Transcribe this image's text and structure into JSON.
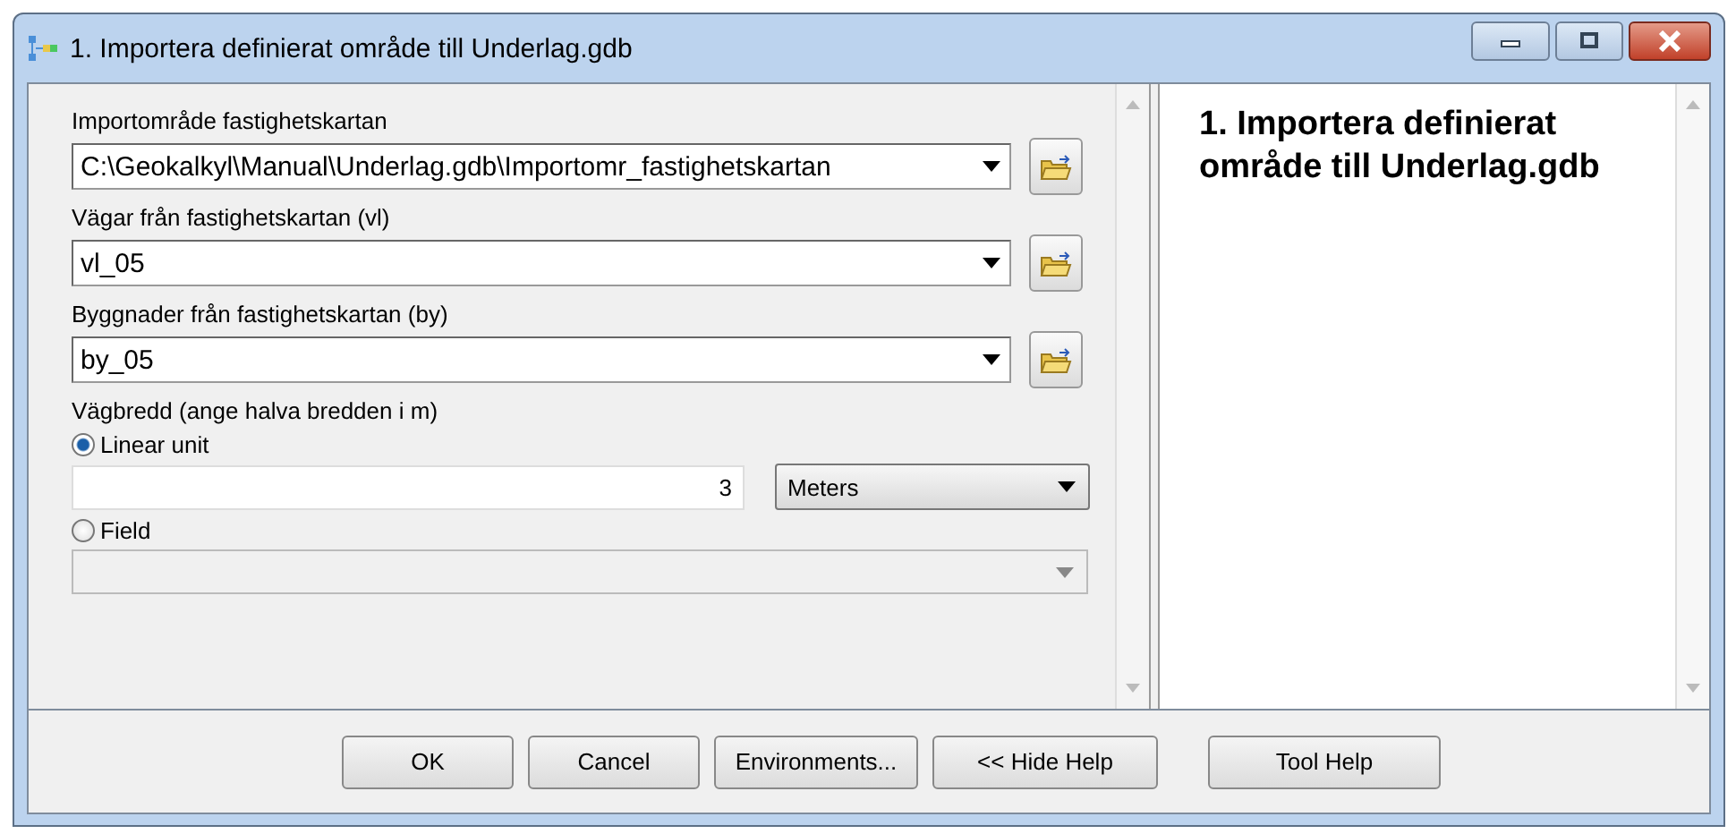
{
  "window": {
    "title": "1. Importera definierat område till Underlag.gdb"
  },
  "parameters": [
    {
      "kind": "dataset",
      "label": "Importområde fastighetskartan",
      "value": "C:\\Geokalkyl\\Manual\\Underlag.gdb\\Importomr_fastighetskartan"
    },
    {
      "kind": "dataset",
      "label": "Vägar från fastighetskartan (vl)",
      "value": "vl_05"
    },
    {
      "kind": "dataset",
      "label": "Byggnader från fastighetskartan (by)",
      "value": "by_05"
    },
    {
      "kind": "choice",
      "label": "Vägbredd (ange halva bredden i m)",
      "options": [
        {
          "kind": "unit",
          "label": "Linear unit",
          "selected": true,
          "value": "3",
          "unit": "Meters"
        },
        {
          "kind": "field",
          "label": "Field",
          "selected": false
        }
      ]
    }
  ],
  "help": {
    "title": "1. Importera definierat område till Underlag.gdb"
  },
  "buttons": [
    {
      "label": "OK"
    },
    {
      "label": "Cancel"
    },
    {
      "label": "Environments..."
    },
    {
      "label": "<< Hide Help"
    },
    {
      "label": "Tool Help"
    }
  ]
}
